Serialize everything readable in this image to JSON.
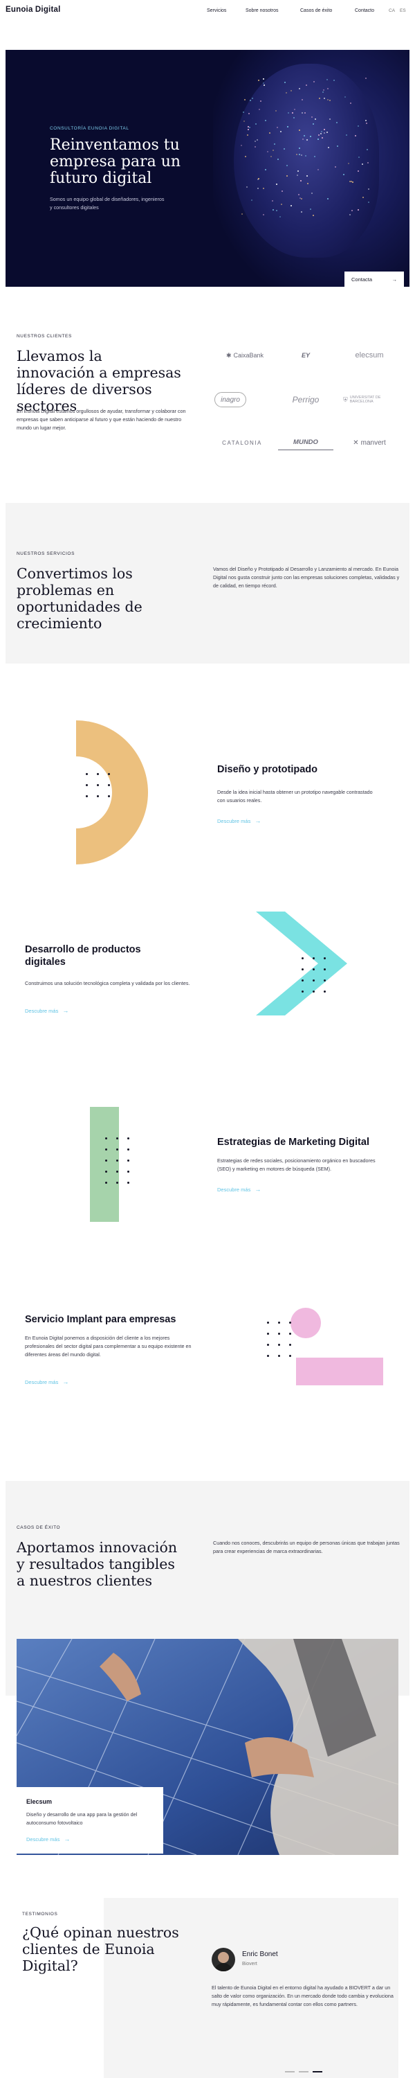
{
  "header": {
    "logo": "Eunoia Digital",
    "nav": [
      "Servicios",
      "Sobre nosotros",
      "Casos de éxito",
      "Contacto"
    ],
    "langs": [
      "CA",
      "ES"
    ]
  },
  "hero": {
    "eyebrow": "CONSULTORÍA EUNOIA DIGITAL",
    "title": "Reinventamos tu empresa para un futuro digital",
    "subtitle": "Somos un equipo global de diseñadores, ingenieros y consultores digitales",
    "cta": "Contacta",
    "cta_arrow": "→"
  },
  "clients": {
    "eyebrow": "NUESTROS CLIENTES",
    "title": "Llevamos la innovación a empresas líderes de diversos sectores",
    "body": "En Eunoia Digital estamos orgullosos de ayudar, transformar y colaborar con empresas que saben anticiparse al futuro y que están haciendo de nuestro mundo un lugar mejor.",
    "logos": [
      "CaixaBank",
      "EY",
      "elecsum",
      "inagro",
      "Perrigo",
      "Universitat de Barcelona",
      "CATALONIA",
      "MUNDO",
      "manvert"
    ]
  },
  "services_intro": {
    "eyebrow": "NUESTROS SERVICIOS",
    "title": "Convertimos los problemas en oportunidades de crecimiento",
    "body": "Vamos del Diseño y Prototipado al Desarrollo y Lanzamiento al mercado. En Eunoia Digital nos gusta construir junto con las empresas soluciones completas, validadas y de calidad, en tiempo récord."
  },
  "services": [
    {
      "title": "Diseño y prototipado",
      "body": "Desde la idea inicial hasta obtener un prototipo navegable contrastado con usuarios reales.",
      "more": "Descubre más"
    },
    {
      "title": "Desarrollo de productos digitales",
      "body": "Construimos una solución tecnológica completa y validada por los clientes.",
      "more": "Descubre más"
    },
    {
      "title": "Estrategias de Marketing Digital",
      "body": "Estrategias de redes sociales, posicionamiento orgánico en buscadores (SEO) y marketing en motores de búsqueda (SEM).",
      "more": "Descubre más"
    },
    {
      "title": "Servicio Implant para empresas",
      "body": "En Eunoia Digital ponemos a disposición del cliente a los mejores profesionales del sector digital para complementar a su equipo existente en diferentes áreas del mundo digital.",
      "more": "Descubre más"
    }
  ],
  "success": {
    "eyebrow": "CASOS DE ÉXITO",
    "title": "Aportamos innovación y resultados tangibles a nuestros clientes",
    "body": "Cuando nos conoces, descubrirás un equipo de personas únicas que trabajan juntas para crear experiencias de marca extraordinarias.",
    "case": {
      "name": "Elecsum",
      "body": "Diseño y desarrollo de una app para la gestión del autoconsumo fotovoltaico",
      "more": "Descubre más"
    }
  },
  "testimonials": {
    "eyebrow": "TESTIMONIOS",
    "title": "¿Qué opinan nuestros clientes de Eunoia Digital?",
    "name": "Enric Bonet",
    "company": "Biovert",
    "quote": "El talento de Eunoia Digital en el entorno digital ha ayudado a BIOVERT a dar un salto de valor como organización. En un mercado donde todo cambia y evoluciona muy rápidamente, es fundamental contar con ellos como partners."
  },
  "colors": {
    "navy": "#090b2e",
    "accent": "#5fc3e4",
    "orange": "#ecc07e",
    "teal": "#7ae2e2",
    "green": "#a6d3ab",
    "pink": "#f0b9df"
  }
}
